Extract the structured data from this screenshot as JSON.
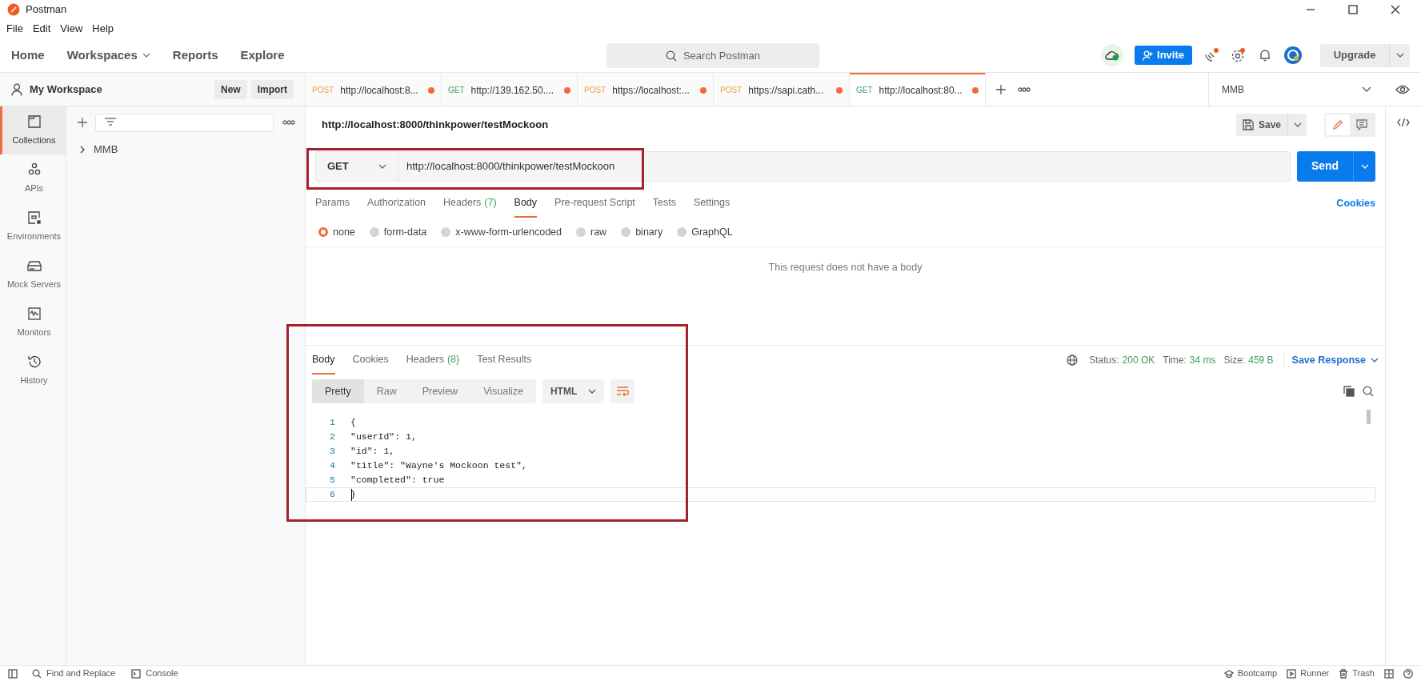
{
  "window": {
    "title": "Postman"
  },
  "menu": [
    "File",
    "Edit",
    "View",
    "Help"
  ],
  "nav": [
    {
      "label": "Home",
      "has_menu": false
    },
    {
      "label": "Workspaces",
      "has_menu": true
    },
    {
      "label": "Reports",
      "has_menu": false
    },
    {
      "label": "Explore",
      "has_menu": false
    }
  ],
  "search": {
    "placeholder": "Search Postman"
  },
  "invite": "Invite",
  "upgrade": "Upgrade",
  "workspace": {
    "name": "My Workspace",
    "buttons": [
      "New",
      "Import"
    ]
  },
  "rail": [
    {
      "label": "Collections",
      "kind": "collections",
      "selected": true
    },
    {
      "label": "APIs",
      "kind": "apis",
      "selected": false
    },
    {
      "label": "Environments",
      "kind": "environments",
      "selected": false
    },
    {
      "label": "Mock Servers",
      "kind": "mock",
      "selected": false
    },
    {
      "label": "Monitors",
      "kind": "monitors",
      "selected": false
    },
    {
      "label": "History",
      "kind": "history",
      "selected": false
    }
  ],
  "collections": [
    {
      "name": "MMB",
      "expanded": false
    }
  ],
  "tabs": [
    {
      "method": "POST",
      "color": "#e8a33d",
      "url": "http://localhost:8...",
      "unsaved": true,
      "selected": false
    },
    {
      "method": "GET",
      "color": "#3e9e5f",
      "url": "http://139.162.50....",
      "unsaved": true,
      "selected": false
    },
    {
      "method": "POST",
      "color": "#e8a33d",
      "url": "https://localhost:...",
      "unsaved": true,
      "selected": false
    },
    {
      "method": "POST",
      "color": "#e8a33d",
      "url": "https://sapi.cath...",
      "unsaved": true,
      "selected": false
    },
    {
      "method": "GET",
      "color": "#3e9e5f",
      "url": "http://localhost:80...",
      "unsaved": true,
      "selected": true
    }
  ],
  "environment": "MMB",
  "request": {
    "title": "http://localhost:8000/thinkpower/testMockoon",
    "save": "Save",
    "method": "GET",
    "url": "http://localhost:8000/thinkpower/testMockoon",
    "send": "Send",
    "tabs": [
      {
        "label": "Params",
        "selected": false
      },
      {
        "label": "Authorization",
        "selected": false
      },
      {
        "label": "Headers",
        "count": "(7)",
        "selected": false
      },
      {
        "label": "Body",
        "selected": true
      },
      {
        "label": "Pre-request Script",
        "selected": false
      },
      {
        "label": "Tests",
        "selected": false
      },
      {
        "label": "Settings",
        "selected": false
      }
    ],
    "cookies": "Cookies",
    "body_types": [
      {
        "label": "none",
        "selected": true
      },
      {
        "label": "form-data",
        "selected": false
      },
      {
        "label": "x-www-form-urlencoded",
        "selected": false
      },
      {
        "label": "raw",
        "selected": false
      },
      {
        "label": "binary",
        "selected": false
      },
      {
        "label": "GraphQL",
        "selected": false
      }
    ],
    "empty_message": "This request does not have a body"
  },
  "response": {
    "tabs": [
      {
        "label": "Body",
        "selected": true
      },
      {
        "label": "Cookies",
        "selected": false
      },
      {
        "label": "Headers",
        "count": "(8)",
        "selected": false
      },
      {
        "label": "Test Results",
        "selected": false
      }
    ],
    "status_label": "Status:",
    "status": "200 OK",
    "time_label": "Time:",
    "time": "34 ms",
    "size_label": "Size:",
    "size": "459 B",
    "save": "Save Response",
    "views": [
      {
        "label": "Pretty",
        "selected": true
      },
      {
        "label": "Raw",
        "selected": false
      },
      {
        "label": "Preview",
        "selected": false
      },
      {
        "label": "Visualize",
        "selected": false
      }
    ],
    "format": "HTML",
    "lines": [
      {
        "number": "1",
        "text": "{",
        "current": false
      },
      {
        "number": "2",
        "text": "\"userId\": 1,",
        "current": false
      },
      {
        "number": "3",
        "text": "\"id\": 1,",
        "current": false
      },
      {
        "number": "4",
        "text": "\"title\": \"Wayne's Mockoon test\",",
        "current": false
      },
      {
        "number": "5",
        "text": "\"completed\": true",
        "current": false
      },
      {
        "number": "6",
        "text": "}",
        "current": true
      }
    ]
  },
  "status_bar": {
    "left": [
      {
        "label": "Find and Replace",
        "kind": "find"
      },
      {
        "label": "Console",
        "kind": "console"
      }
    ],
    "right": [
      {
        "label": "Bootcamp",
        "kind": "bootcamp"
      },
      {
        "label": "Runner",
        "kind": "runner"
      },
      {
        "label": "Trash",
        "kind": "trash"
      }
    ]
  }
}
